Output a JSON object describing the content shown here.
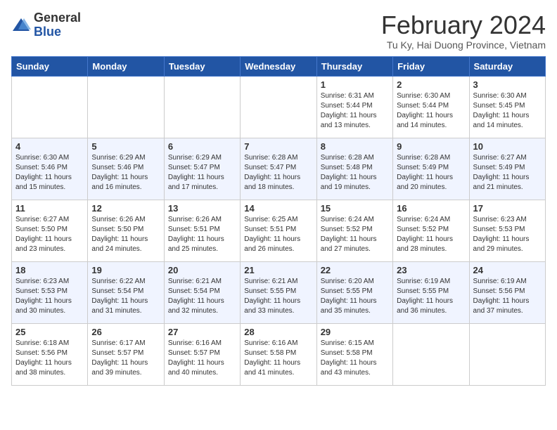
{
  "logo": {
    "general": "General",
    "blue": "Blue"
  },
  "title": "February 2024",
  "subtitle": "Tu Ky, Hai Duong Province, Vietnam",
  "days_header": [
    "Sunday",
    "Monday",
    "Tuesday",
    "Wednesday",
    "Thursday",
    "Friday",
    "Saturday"
  ],
  "weeks": [
    [
      {
        "day": "",
        "info": ""
      },
      {
        "day": "",
        "info": ""
      },
      {
        "day": "",
        "info": ""
      },
      {
        "day": "",
        "info": ""
      },
      {
        "day": "1",
        "info": "Sunrise: 6:31 AM\nSunset: 5:44 PM\nDaylight: 11 hours and 13 minutes."
      },
      {
        "day": "2",
        "info": "Sunrise: 6:30 AM\nSunset: 5:44 PM\nDaylight: 11 hours and 14 minutes."
      },
      {
        "day": "3",
        "info": "Sunrise: 6:30 AM\nSunset: 5:45 PM\nDaylight: 11 hours and 14 minutes."
      }
    ],
    [
      {
        "day": "4",
        "info": "Sunrise: 6:30 AM\nSunset: 5:46 PM\nDaylight: 11 hours and 15 minutes."
      },
      {
        "day": "5",
        "info": "Sunrise: 6:29 AM\nSunset: 5:46 PM\nDaylight: 11 hours and 16 minutes."
      },
      {
        "day": "6",
        "info": "Sunrise: 6:29 AM\nSunset: 5:47 PM\nDaylight: 11 hours and 17 minutes."
      },
      {
        "day": "7",
        "info": "Sunrise: 6:28 AM\nSunset: 5:47 PM\nDaylight: 11 hours and 18 minutes."
      },
      {
        "day": "8",
        "info": "Sunrise: 6:28 AM\nSunset: 5:48 PM\nDaylight: 11 hours and 19 minutes."
      },
      {
        "day": "9",
        "info": "Sunrise: 6:28 AM\nSunset: 5:49 PM\nDaylight: 11 hours and 20 minutes."
      },
      {
        "day": "10",
        "info": "Sunrise: 6:27 AM\nSunset: 5:49 PM\nDaylight: 11 hours and 21 minutes."
      }
    ],
    [
      {
        "day": "11",
        "info": "Sunrise: 6:27 AM\nSunset: 5:50 PM\nDaylight: 11 hours and 23 minutes."
      },
      {
        "day": "12",
        "info": "Sunrise: 6:26 AM\nSunset: 5:50 PM\nDaylight: 11 hours and 24 minutes."
      },
      {
        "day": "13",
        "info": "Sunrise: 6:26 AM\nSunset: 5:51 PM\nDaylight: 11 hours and 25 minutes."
      },
      {
        "day": "14",
        "info": "Sunrise: 6:25 AM\nSunset: 5:51 PM\nDaylight: 11 hours and 26 minutes."
      },
      {
        "day": "15",
        "info": "Sunrise: 6:24 AM\nSunset: 5:52 PM\nDaylight: 11 hours and 27 minutes."
      },
      {
        "day": "16",
        "info": "Sunrise: 6:24 AM\nSunset: 5:52 PM\nDaylight: 11 hours and 28 minutes."
      },
      {
        "day": "17",
        "info": "Sunrise: 6:23 AM\nSunset: 5:53 PM\nDaylight: 11 hours and 29 minutes."
      }
    ],
    [
      {
        "day": "18",
        "info": "Sunrise: 6:23 AM\nSunset: 5:53 PM\nDaylight: 11 hours and 30 minutes."
      },
      {
        "day": "19",
        "info": "Sunrise: 6:22 AM\nSunset: 5:54 PM\nDaylight: 11 hours and 31 minutes."
      },
      {
        "day": "20",
        "info": "Sunrise: 6:21 AM\nSunset: 5:54 PM\nDaylight: 11 hours and 32 minutes."
      },
      {
        "day": "21",
        "info": "Sunrise: 6:21 AM\nSunset: 5:55 PM\nDaylight: 11 hours and 33 minutes."
      },
      {
        "day": "22",
        "info": "Sunrise: 6:20 AM\nSunset: 5:55 PM\nDaylight: 11 hours and 35 minutes."
      },
      {
        "day": "23",
        "info": "Sunrise: 6:19 AM\nSunset: 5:55 PM\nDaylight: 11 hours and 36 minutes."
      },
      {
        "day": "24",
        "info": "Sunrise: 6:19 AM\nSunset: 5:56 PM\nDaylight: 11 hours and 37 minutes."
      }
    ],
    [
      {
        "day": "25",
        "info": "Sunrise: 6:18 AM\nSunset: 5:56 PM\nDaylight: 11 hours and 38 minutes."
      },
      {
        "day": "26",
        "info": "Sunrise: 6:17 AM\nSunset: 5:57 PM\nDaylight: 11 hours and 39 minutes."
      },
      {
        "day": "27",
        "info": "Sunrise: 6:16 AM\nSunset: 5:57 PM\nDaylight: 11 hours and 40 minutes."
      },
      {
        "day": "28",
        "info": "Sunrise: 6:16 AM\nSunset: 5:58 PM\nDaylight: 11 hours and 41 minutes."
      },
      {
        "day": "29",
        "info": "Sunrise: 6:15 AM\nSunset: 5:58 PM\nDaylight: 11 hours and 43 minutes."
      },
      {
        "day": "",
        "info": ""
      },
      {
        "day": "",
        "info": ""
      }
    ]
  ]
}
